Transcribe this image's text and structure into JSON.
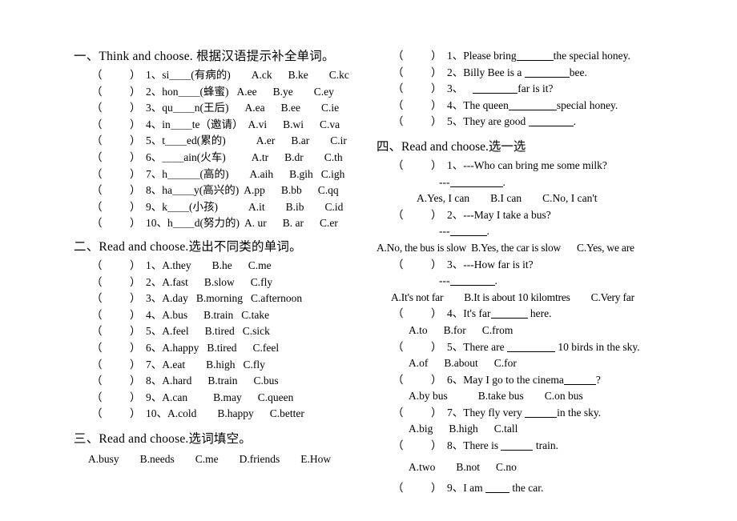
{
  "document": {
    "title": "Primary English Exercise Worksheet",
    "background_color": "#ffffff",
    "text_color": "#000000"
  },
  "left_column": {
    "section1": {
      "heading": "一、Think and choose. 根据汉语提示补全单词。",
      "items": [
        {
          "paren_open": "（",
          "paren_close": "）",
          "number": "1、",
          "stem": "si＿＿(有病的)",
          "a": "A.ck",
          "b": "B.ke",
          "c": "C.kc"
        },
        {
          "paren_open": "（",
          "paren_close": "）",
          "number": "2、",
          "stem": "hon＿＿(蜂蜜)",
          "a": "A.ee",
          "b": "B.ye",
          "c": "C.ey"
        },
        {
          "paren_open": "（",
          "paren_close": "）",
          "number": "3、",
          "stem": "qu＿＿n(王后)",
          "a": "A.ea",
          "b": "B.ee",
          "c": "C.ie"
        },
        {
          "paren_open": "（",
          "paren_close": "）",
          "number": "4、",
          "stem": "in＿＿te（邀请）",
          "a": "A.vi",
          "b": "B.wi",
          "c": "C.va"
        },
        {
          "paren_open": "（",
          "paren_close": "）",
          "number": "5、",
          "stem": "t＿＿ed(累的)",
          "a": "A.er",
          "b": "B.ar",
          "c": "C.ir"
        },
        {
          "paren_open": "（",
          "paren_close": "）",
          "number": "6、",
          "stem": "＿＿ain(火车)",
          "a": "A.tr",
          "b": "B.dr",
          "c": "C.th"
        },
        {
          "paren_open": "（",
          "paren_close": "）",
          "number": "7、",
          "stem": "h＿＿＿(高的)",
          "a": "A.aih",
          "b": "B.gih",
          "c": "C.igh"
        },
        {
          "paren_open": "（",
          "paren_close": "）",
          "number": "8、",
          "stem": "ha＿＿y(高兴的)",
          "a": "A.pp",
          "b": "B.bb",
          "c": "C.qq"
        },
        {
          "paren_open": "（",
          "paren_close": "）",
          "number": "9、",
          "stem": "k＿＿(小孩)",
          "a": "A.it",
          "b": "B.ib",
          "c": "C.id"
        },
        {
          "paren_open": "（",
          "paren_close": "）",
          "number": "10、",
          "stem": "h＿＿d(努力的)",
          "a": "A. ur",
          "b": "B. ar",
          "c": "C.er"
        }
      ]
    },
    "section2": {
      "heading": "二、Read and choose.选出不同类的单词。",
      "items": [
        {
          "paren_open": "（",
          "paren_close": "）",
          "number": "1、",
          "a": "A.they",
          "b": "B.he",
          "c": "C.me"
        },
        {
          "paren_open": "（",
          "paren_close": "）",
          "number": "2、",
          "a": "A.fast",
          "b": "B.slow",
          "c": "C.fly"
        },
        {
          "paren_open": "（",
          "paren_close": "）",
          "number": "3、",
          "a": "A.day",
          "b": "B.morning",
          "c": "C.afternoon"
        },
        {
          "paren_open": "（",
          "paren_close": "）",
          "number": "4、",
          "a": "A.bus",
          "b": "B.train",
          "c": "C.take"
        },
        {
          "paren_open": "（",
          "paren_close": "）",
          "number": "5、",
          "a": "A.feel",
          "b": "B.tired",
          "c": "C.sick"
        },
        {
          "paren_open": "（",
          "paren_close": "）",
          "number": "6、",
          "a": "A.happy",
          "b": "B.tired",
          "c": "C.feel"
        },
        {
          "paren_open": "（",
          "paren_close": "）",
          "number": "7、",
          "a": "A.eat",
          "b": "B.high",
          "c": "C.fly"
        },
        {
          "paren_open": "（",
          "paren_close": "）",
          "number": "8、",
          "a": "A.hard",
          "b": "B.train",
          "c": "C.bus"
        },
        {
          "paren_open": "（",
          "paren_close": "）",
          "number": "9、",
          "a": "A.can",
          "b": "B.may",
          "c": "C.queen"
        },
        {
          "paren_open": "（",
          "paren_close": "）",
          "number": "10、",
          "a": "A.cold",
          "b": "B.happy",
          "c": "C.better"
        }
      ]
    },
    "section3": {
      "heading": "三、Read and choose.选词填空。",
      "word_bank": [
        "A.busy",
        "B.needs",
        "C.me",
        "D.friends",
        "E.How"
      ]
    }
  },
  "right_column": {
    "section3_items": [
      {
        "paren_open": "（",
        "paren_close": "）",
        "number": "1、",
        "before": "Please bring",
        "after": "the special honey."
      },
      {
        "paren_open": "（",
        "paren_close": "）",
        "number": "2、",
        "before": "Billy Bee is a ",
        "after": "bee."
      },
      {
        "paren_open": "（",
        "paren_close": "）",
        "number": "3、",
        "before": "",
        "after": "far is it?"
      },
      {
        "paren_open": "（",
        "paren_close": "）",
        "number": "4、",
        "before": "The queen",
        "after": "special honey."
      },
      {
        "paren_open": "（",
        "paren_close": "）",
        "number": "5、",
        "before": "They are good ",
        "after": "."
      }
    ],
    "section4": {
      "heading": "四、Read and choose.选一选",
      "items": [
        {
          "paren_open": "（",
          "paren_close": "）",
          "number": "1、",
          "question": "---Who can bring me some milk?",
          "answer_prompt": "---",
          "answer_punct": ".",
          "a": "A.Yes, I can",
          "b": "B.I can",
          "c": "C.No, I can't"
        },
        {
          "paren_open": "（",
          "paren_close": "）",
          "number": "2、",
          "question": "---May I take a bus?",
          "answer_prompt": "---",
          "answer_punct": ".",
          "a": "A.No, the bus is slow",
          "b": "B.Yes, the car is slow",
          "c": "C.Yes, we are"
        },
        {
          "paren_open": "（",
          "paren_close": "）",
          "number": "3、",
          "question": "---How far is it?",
          "answer_prompt": "---",
          "answer_punct": ".",
          "a": "A.It's not far",
          "b": "B.It is about 10 kilomtres",
          "c": "C.Very far"
        },
        {
          "paren_open": "（",
          "paren_close": "）",
          "number": "4、",
          "question_before": "It's far",
          "question_after": " here.",
          "a": "A.to",
          "b": "B.for",
          "c": "C.from"
        },
        {
          "paren_open": "（",
          "paren_close": "）",
          "number": "5、",
          "question_before": "There are ",
          "question_after": " 10 birds in the sky.",
          "a": "A.of",
          "b": "B.about",
          "c": "C.for"
        },
        {
          "paren_open": "（",
          "paren_close": "）",
          "number": "6、",
          "question_before": "May I go to the cinema",
          "question_after": "?",
          "a": "A.by bus",
          "b": "B.take bus",
          "c": "C.on bus"
        },
        {
          "paren_open": "（",
          "paren_close": "）",
          "number": "7、",
          "question_before": "They fly very ",
          "question_after": "in the sky.",
          "a": "A.big",
          "b": "B.high",
          "c": "C.tall"
        },
        {
          "paren_open": "（",
          "paren_close": "）",
          "number": "8、",
          "question_before": "There is ",
          "question_after": " train.",
          "a": "A.two",
          "b": "B.not",
          "c": "C.no"
        },
        {
          "paren_open": "（",
          "paren_close": "）",
          "number": "9、",
          "question_before": "I am ",
          "question_after": " the car.",
          "a": "",
          "b": "",
          "c": ""
        }
      ]
    }
  }
}
